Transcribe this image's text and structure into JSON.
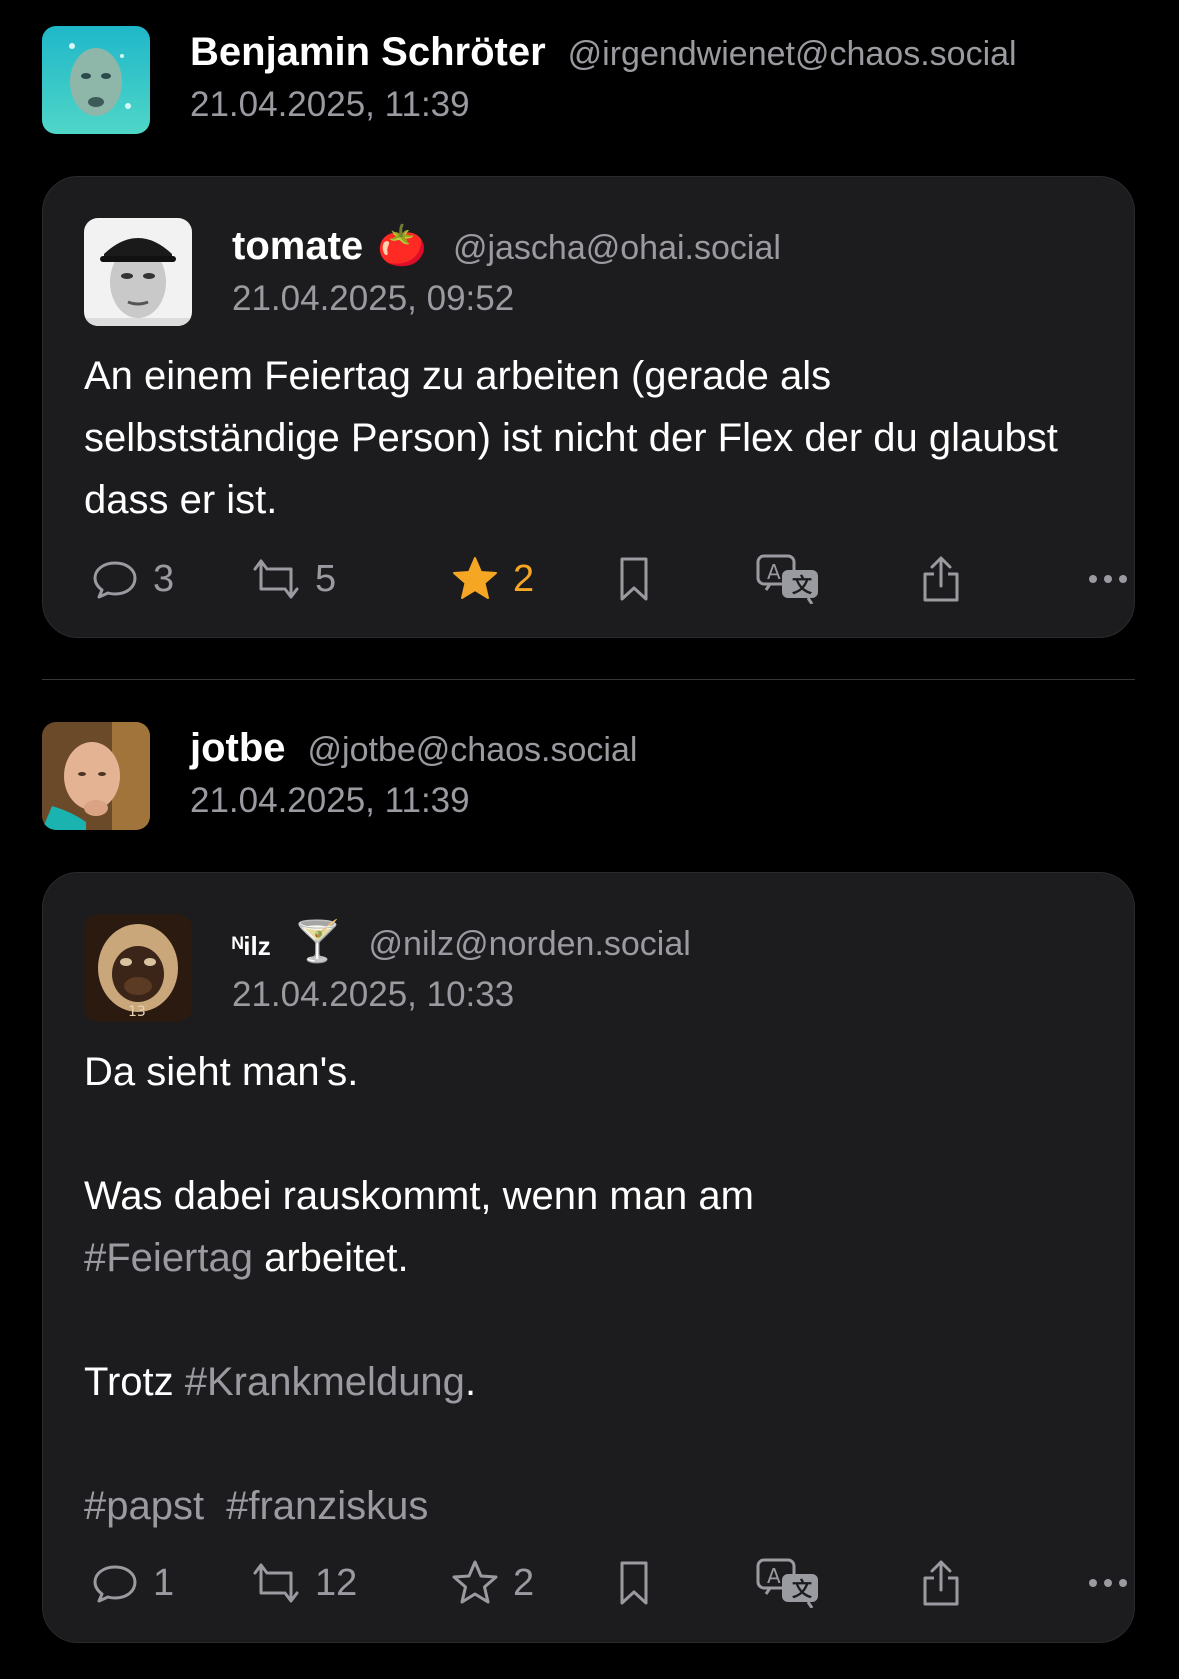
{
  "posts": [
    {
      "booster": {
        "name": "Benjamin Schröter",
        "handle": "@irgendwienet@chaos.social",
        "time": "21.04.2025, 11:39"
      },
      "quoted": {
        "author_name": "tomate",
        "author_emoji": "🍅",
        "handle": "@jascha@ohai.social",
        "time": "21.04.2025, 09:52",
        "text": "An einem Feiertag zu arbeiten (gerade als selbstständige Person) ist nicht der Flex der du glaubst dass er ist.",
        "replies": "3",
        "boosts": "5",
        "favorites": "2",
        "favorited": true
      }
    },
    {
      "booster": {
        "name": "jotbe",
        "handle": "@jotbe@chaos.social",
        "time": "21.04.2025, 11:39"
      },
      "quoted": {
        "author_name": "ᴺilz",
        "author_emoji": "🍸",
        "handle": "@nilz@norden.social",
        "time": "21.04.2025, 10:33",
        "line1": "Da sieht man's.",
        "line2a": "Was dabei rauskommt, wenn man am",
        "tag_feiertag": "#Feiertag",
        "line2b": " arbeitet.",
        "line3a": "Trotz ",
        "tag_krank": "#Krankmeldung",
        "line3b": ".",
        "tag_papst": "#papst",
        "tag_franziskus": "#franziskus",
        "replies": "1",
        "boosts": "12",
        "favorites": "2",
        "favorited": false
      }
    }
  ],
  "colors": {
    "background": "#000000",
    "card": "#1c1c1e",
    "secondary_text": "#9a9aa1",
    "favorite_accent": "#f5a623"
  },
  "icons": [
    "reply-icon",
    "boost-icon",
    "star-icon",
    "bookmark-icon",
    "translate-icon",
    "share-icon",
    "more-icon"
  ]
}
